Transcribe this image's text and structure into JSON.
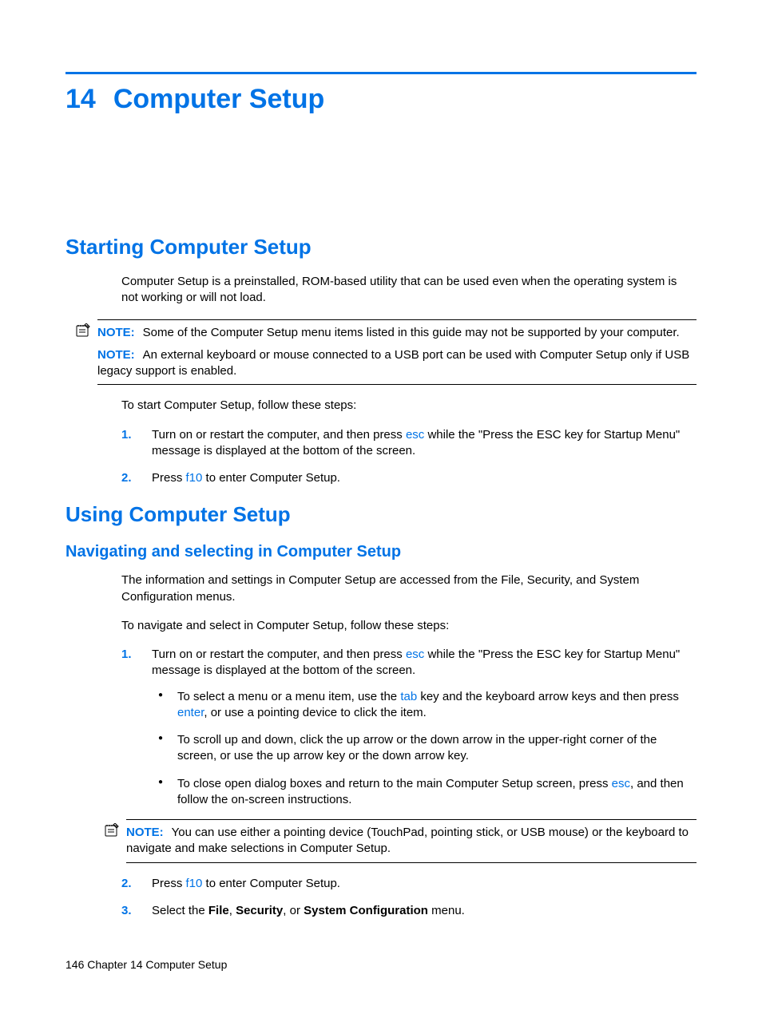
{
  "chapter": {
    "number": "14",
    "title": "Computer Setup"
  },
  "section1": {
    "heading": "Starting Computer Setup",
    "intro": "Computer Setup is a preinstalled, ROM-based utility that can be used even when the operating system is not working or will not load.",
    "note1": {
      "label": "NOTE:",
      "text": "Some of the Computer Setup menu items listed in this guide may not be supported by your computer."
    },
    "note2": {
      "label": "NOTE:",
      "text": "An external keyboard or mouse connected to a USB port can be used with Computer Setup only if USB legacy support is enabled."
    },
    "lead": "To start Computer Setup, follow these steps:",
    "steps": {
      "s1": {
        "num": "1.",
        "pre": "Turn on or restart the computer, and then press ",
        "key": "esc",
        "post": " while the \"Press the ESC key for Startup Menu\" message is displayed at the bottom of the screen."
      },
      "s2": {
        "num": "2.",
        "pre": "Press ",
        "key": "f10",
        "post": " to enter Computer Setup."
      }
    }
  },
  "section2": {
    "heading": "Using Computer Setup",
    "sub1": {
      "heading": "Navigating and selecting in Computer Setup",
      "intro": "The information and settings in Computer Setup are accessed from the File, Security, and System Configuration menus.",
      "lead": "To navigate and select in Computer Setup, follow these steps:",
      "steps": {
        "s1": {
          "num": "1.",
          "pre": "Turn on or restart the computer, and then press ",
          "key": "esc",
          "post": " while the \"Press the ESC key for Startup Menu\" message is displayed at the bottom of the screen.",
          "bullets": {
            "b1": {
              "t1": "To select a menu or a menu item, use the ",
              "k1": "tab",
              "t2": " key and the keyboard arrow keys and then press ",
              "k2": "enter",
              "t3": ", or use a pointing device to click the item."
            },
            "b2": "To scroll up and down, click the up arrow or the down arrow in the upper-right corner of the screen, or use the up arrow key or the down arrow key.",
            "b3": {
              "t1": "To close open dialog boxes and return to the main Computer Setup screen, press ",
              "k1": "esc",
              "t2": ", and then follow the on-screen instructions."
            }
          },
          "note": {
            "label": "NOTE:",
            "text": "You can use either a pointing device (TouchPad, pointing stick, or USB mouse) or the keyboard to navigate and make selections in Computer Setup."
          }
        },
        "s2": {
          "num": "2.",
          "pre": "Press ",
          "key": "f10",
          "post": " to enter Computer Setup."
        },
        "s3": {
          "num": "3.",
          "t1": "Select the ",
          "b1": "File",
          "t2": ", ",
          "b2": "Security",
          "t3": ", or ",
          "b3": "System Configuration",
          "t4": " menu."
        }
      }
    }
  },
  "footer": "146   Chapter 14   Computer Setup"
}
